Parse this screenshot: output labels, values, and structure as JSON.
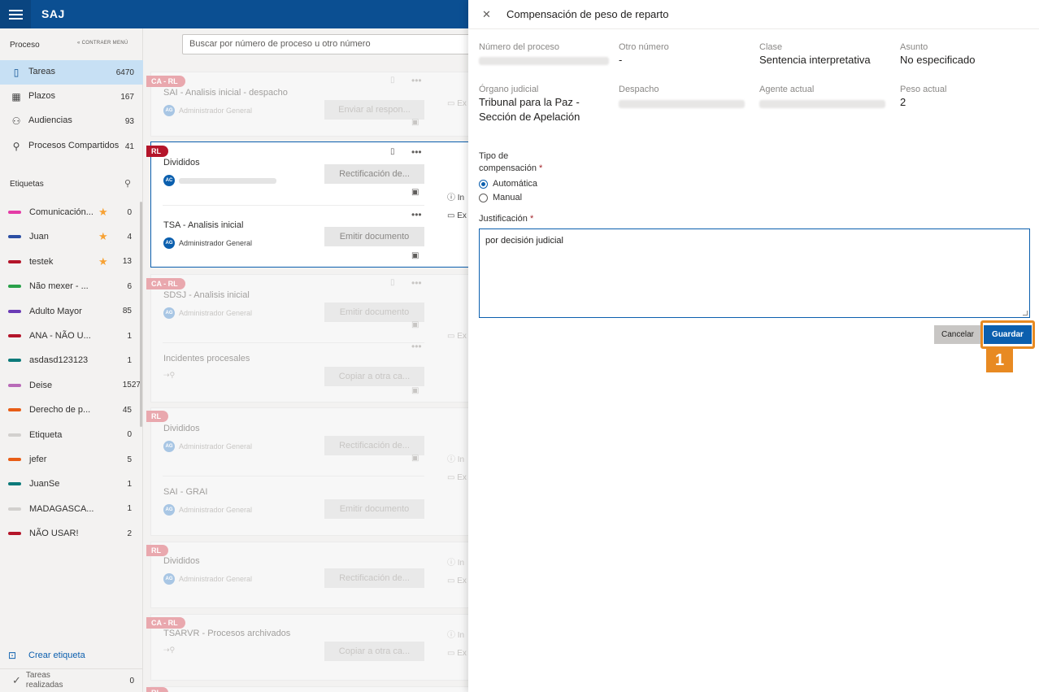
{
  "app": {
    "brand": "SAJ"
  },
  "sidebar": {
    "heading": "Proceso",
    "collapse_label": "CONTRAER MENÚ",
    "nav": [
      {
        "label": "Tareas",
        "count": "6470",
        "icon": "clipboard-icon"
      },
      {
        "label": "Plazos",
        "count": "167",
        "icon": "calendar-icon"
      },
      {
        "label": "Audiencias",
        "count": "93",
        "icon": "people-icon"
      },
      {
        "label": "Procesos Compartidos",
        "count": "41",
        "icon": "share-people-icon"
      }
    ],
    "tags_heading": "Etiquetas",
    "tags": [
      {
        "label": "Comunicación...",
        "count": "0",
        "color": "#e43ba6",
        "star": true
      },
      {
        "label": "Juan",
        "count": "4",
        "color": "#2b4ea3",
        "star": true
      },
      {
        "label": "testek",
        "count": "13",
        "color": "#b4152a",
        "star": true
      },
      {
        "label": "Não mexer - ...",
        "count": "6",
        "color": "#2aa14a",
        "star": false
      },
      {
        "label": "Adulto Mayor",
        "count": "85",
        "color": "#6a3bb5",
        "star": false
      },
      {
        "label": "ANA - NÃO U...",
        "count": "1",
        "color": "#b4152a",
        "star": false
      },
      {
        "label": "asdasd123123",
        "count": "1",
        "color": "#0c7a7a",
        "star": false
      },
      {
        "label": "Deise",
        "count": "1527",
        "color": "#b86bb8",
        "star": false
      },
      {
        "label": "Derecho de p...",
        "count": "45",
        "color": "#e85d16",
        "star": false
      },
      {
        "label": "Etiqueta",
        "count": "0",
        "color": "#d2d0ce",
        "star": false
      },
      {
        "label": "jefer",
        "count": "5",
        "color": "#e85d16",
        "star": false
      },
      {
        "label": "JuanSe",
        "count": "1",
        "color": "#0c7a7a",
        "star": false
      },
      {
        "label": "MADAGASCA...",
        "count": "1",
        "color": "#d2d0ce",
        "star": false
      },
      {
        "label": "NÃO USAR!",
        "count": "2",
        "color": "#b4152a",
        "star": false
      }
    ],
    "create_tag": "Crear etiqueta",
    "done_tasks": "Tareas realizadas",
    "done_count": "0"
  },
  "main": {
    "search_placeholder": "Buscar por número de proceso u otro número",
    "cards": [
      {
        "badge": "CA - RL",
        "items": [
          {
            "title": "SAI - Analisis inicial - despacho",
            "owner": "Administrador General",
            "initials": "AG",
            "button": "Enviar al respon..."
          }
        ],
        "side1": "Ex"
      },
      {
        "badge": "RL",
        "items": [
          {
            "title": "Divididos",
            "owner": "",
            "initials": "AC",
            "button": "Rectificación de..."
          },
          {
            "title": "TSA - Analisis inicial",
            "owner": "Administrador General",
            "initials": "AG",
            "button": "Emitir documento"
          }
        ],
        "side1": "In",
        "side2": "Ex"
      },
      {
        "badge": "CA - RL",
        "items": [
          {
            "title": "SDSJ - Analisis inicial",
            "owner": "Administrador General",
            "initials": "AG",
            "button": "Emitir documento"
          },
          {
            "title": "Incidentes procesales",
            "owner": "",
            "initials": "",
            "button": "Copiar a otra ca..."
          }
        ],
        "side1": "Ex"
      },
      {
        "badge": "RL",
        "items": [
          {
            "title": "Divididos",
            "owner": "Administrador General",
            "initials": "AG",
            "button": "Rectificación de..."
          },
          {
            "title": "SAI - GRAI",
            "owner": "Administrador General",
            "initials": "AG",
            "button": "Emitir documento"
          }
        ],
        "side1": "In",
        "side2": "Ex"
      },
      {
        "badge": "RL",
        "items": [
          {
            "title": "Divididos",
            "owner": "Administrador General",
            "initials": "AG",
            "button": "Rectificación de..."
          }
        ],
        "side1": "In",
        "side2": "Ex"
      },
      {
        "badge": "CA - RL",
        "items": [
          {
            "title": "TSARVR - Procesos archivados",
            "owner": "",
            "initials": "",
            "button": "Copiar a otra ca..."
          }
        ],
        "side1": "In",
        "side2": "Ex"
      },
      {
        "badge": "RL",
        "items": []
      }
    ]
  },
  "panel": {
    "title": "Compensación de peso de reparto",
    "fields": {
      "numero_label": "Número del proceso",
      "otro_label": "Otro número",
      "otro_value": "-",
      "clase_label": "Clase",
      "clase_value": "Sentencia interpretativa",
      "asunto_label": "Asunto",
      "asunto_value": "No especificado",
      "organo_label": "Órgano judicial",
      "organo_value": "Tribunal para la Paz - Sección de Apelación",
      "despacho_label": "Despacho",
      "agente_label": "Agente actual",
      "peso_label": "Peso actual",
      "peso_value": "2"
    },
    "tipo_label": "Tipo de compensación",
    "required_mark": "*",
    "radio_auto": "Automática",
    "radio_manual": "Manual",
    "radio_selected": "Automática",
    "justificacion_label": "Justificación",
    "justificacion_value": "por decisión judicial",
    "cancel": "Cancelar",
    "save": "Guardar",
    "step_marker": "1",
    "accent": "#0b5fae",
    "highlight": "#e88a22"
  }
}
